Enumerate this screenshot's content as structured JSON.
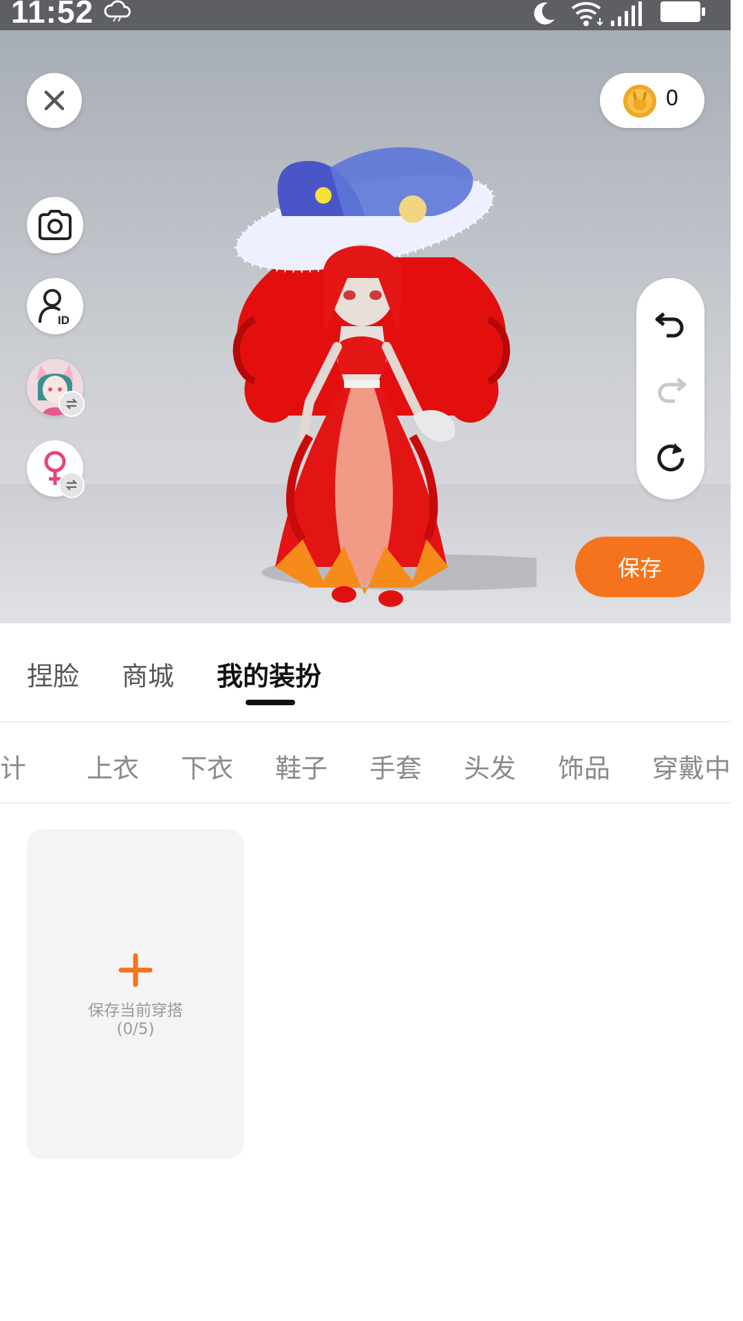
{
  "status_bar": {
    "time": "11:52",
    "icons": [
      "cloud-icon",
      "moon-icon",
      "wifi-icon",
      "signal-icon",
      "battery-icon"
    ]
  },
  "viewer": {
    "coins": "0",
    "save_label": "保存",
    "left_tools": [
      "close-icon",
      "camera-icon",
      "avatar-id-icon",
      "skin-switch-icon",
      "gender-switch-icon"
    ],
    "history_tools": [
      "undo-icon",
      "redo-icon",
      "reset-icon"
    ]
  },
  "main_tabs": {
    "face": "捏脸",
    "shop": "商城",
    "my_outfits": "我的装扮",
    "active": "我的装扮"
  },
  "category_tabs": [
    "设计",
    "上衣",
    "下衣",
    "鞋子",
    "手套",
    "头发",
    "饰品",
    "穿戴中"
  ],
  "outfit_grid": {
    "add_label": "保存当前穿搭",
    "add_count": "(0/5)"
  },
  "colors": {
    "accent": "#f5731c",
    "status_bar": "#5d5f63",
    "tab_active": "#111111",
    "tab_inactive": "#8a8a8a"
  }
}
